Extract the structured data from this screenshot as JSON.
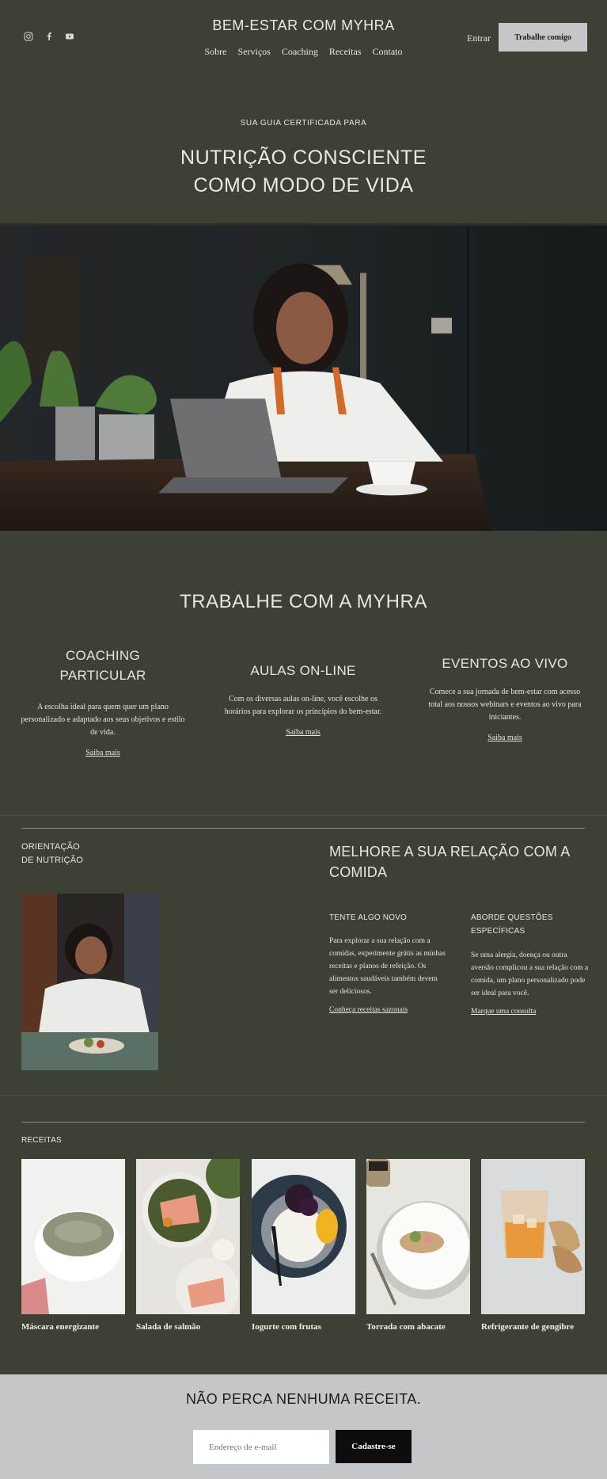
{
  "header": {
    "social_icons": [
      "instagram-icon",
      "facebook-icon",
      "youtube-icon"
    ],
    "brand": "BEM-ESTAR COM MYHRA",
    "nav": [
      "Sobre",
      "Serviços",
      "Coaching",
      "Receitas",
      "Contato"
    ],
    "login": "Entrar",
    "cta": "Trabalhe comigo"
  },
  "hero": {
    "eyebrow": "SUA GUIA CERTIFICADA PARA",
    "title_line1": "NUTRIÇÃO CONSCIENTE",
    "title_line2": "COMO MODO DE VIDA"
  },
  "work": {
    "title": "TRABALHE COM A MYHRA",
    "columns": [
      {
        "title_line1": "COACHING",
        "title_line2": "PARTICULAR",
        "text": "A escolha ideal para quem quer um plano personalizado e adaptado aos seus objetivos e estilo de vida.",
        "link": "Saiba mais"
      },
      {
        "title_line1": "AULAS ON-LINE",
        "title_line2": "",
        "text": "Com os diversas aulas on-line, você escolhe os horários para explorar os princípios do bem-estar.",
        "link": "Saiba mais"
      },
      {
        "title_line1": "EVENTOS AO VIVO",
        "title_line2": "",
        "text": "Comece a sua jornada de bem-estar com acesso total aos nossos webinars e eventos ao vivo para iniciantes.",
        "link": "Saiba mais"
      }
    ]
  },
  "nutrition": {
    "label_line1": "ORIENTAÇÃO",
    "label_line2": "DE NUTRIÇÃO",
    "title": "MELHORE A SUA RELAÇÃO COM A COMIDA",
    "blocks": [
      {
        "heading": "TENTE ALGO NOVO",
        "text": "Para explorar a sua relação com a comidas, experimente grátis as minhas receitas e planos de refeição. Os alimentos saudáveis também devem ser deliciosos.",
        "link": "Conheça receitas sazonais"
      },
      {
        "heading": "ABORDE QUESTÕES ESPECÍFICAS",
        "text": "Se uma alergia, doença ou outra aversão complicou a sua relação com a comida, um plano personalizado pode ser ideal para você.",
        "link": "Marque uma consulta"
      }
    ]
  },
  "recipes": {
    "label": "RECEITAS",
    "items": [
      {
        "name": "Máscara energizante"
      },
      {
        "name": "Salada de salmão"
      },
      {
        "name": "Iogurte com frutas"
      },
      {
        "name": "Torrada com abacate"
      },
      {
        "name": "Refrigerante de gengibre"
      }
    ]
  },
  "newsletter": {
    "title": "NÃO PERCA NENHUMA RECEITA.",
    "placeholder": "Endereço de e-mail",
    "button": "Cadastre-se"
  },
  "colors": {
    "background": "#3c4133",
    "light_panel": "#c4c7c9",
    "text": "#e6e7e0",
    "button_dark": "#0d0d0d"
  }
}
